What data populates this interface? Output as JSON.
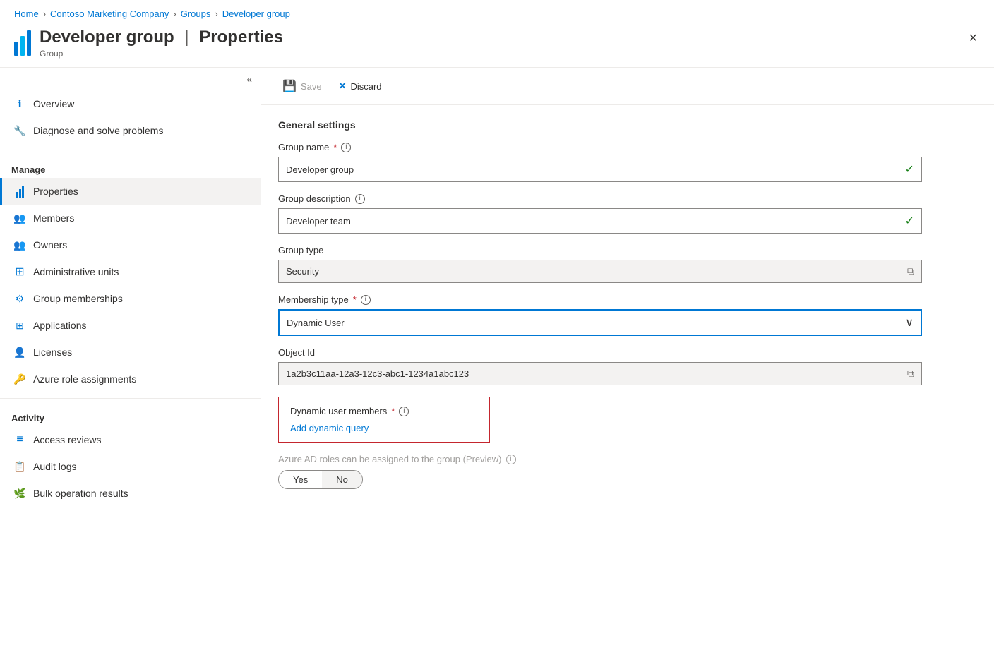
{
  "breadcrumb": {
    "items": [
      "Home",
      "Contoso Marketing Company",
      "Groups",
      "Developer group"
    ]
  },
  "header": {
    "title": "Developer group",
    "separator": "|",
    "subtitle": "Properties",
    "group_label": "Group",
    "close_label": "×"
  },
  "toolbar": {
    "save_label": "Save",
    "discard_label": "Discard"
  },
  "sidebar": {
    "collapse_label": "«",
    "items": [
      {
        "id": "overview",
        "label": "Overview",
        "icon": "ℹ",
        "icon_type": "blue",
        "active": false
      },
      {
        "id": "diagnose",
        "label": "Diagnose and solve problems",
        "icon": "✕",
        "icon_type": "blue",
        "active": false
      }
    ],
    "manage_label": "Manage",
    "manage_items": [
      {
        "id": "properties",
        "label": "Properties",
        "icon": "|||",
        "icon_type": "blue",
        "active": true
      },
      {
        "id": "members",
        "label": "Members",
        "icon": "👥",
        "icon_type": "blue",
        "active": false
      },
      {
        "id": "owners",
        "label": "Owners",
        "icon": "👥",
        "icon_type": "blue",
        "active": false
      },
      {
        "id": "admin-units",
        "label": "Administrative units",
        "icon": "⊞",
        "icon_type": "blue",
        "active": false
      },
      {
        "id": "group-memberships",
        "label": "Group memberships",
        "icon": "⚙",
        "icon_type": "blue",
        "active": false
      },
      {
        "id": "applications",
        "label": "Applications",
        "icon": "⊞",
        "icon_type": "blue",
        "active": false
      },
      {
        "id": "licenses",
        "label": "Licenses",
        "icon": "👤",
        "icon_type": "blue",
        "active": false
      },
      {
        "id": "azure-roles",
        "label": "Azure role assignments",
        "icon": "🔑",
        "icon_type": "orange",
        "active": false
      }
    ],
    "activity_label": "Activity",
    "activity_items": [
      {
        "id": "access-reviews",
        "label": "Access reviews",
        "icon": "≡",
        "icon_type": "blue",
        "active": false
      },
      {
        "id": "audit-logs",
        "label": "Audit logs",
        "icon": "📋",
        "icon_type": "blue",
        "active": false
      },
      {
        "id": "bulk-results",
        "label": "Bulk operation results",
        "icon": "🌿",
        "icon_type": "green",
        "active": false
      }
    ]
  },
  "form": {
    "general_settings_label": "General settings",
    "group_name_label": "Group name",
    "group_name_value": "Developer group",
    "group_description_label": "Group description",
    "group_description_value": "Developer team",
    "group_type_label": "Group type",
    "group_type_value": "Security",
    "membership_type_label": "Membership type",
    "membership_type_value": "Dynamic User",
    "object_id_label": "Object Id",
    "object_id_value": "1a2b3c11aa-12a3-12c3-abc1-1234a1abc123",
    "dynamic_members_label": "Dynamic user members",
    "add_dynamic_query_label": "Add dynamic query",
    "azure_ad_label": "Azure AD roles can be assigned to the group (Preview)",
    "yes_label": "Yes",
    "no_label": "No"
  }
}
